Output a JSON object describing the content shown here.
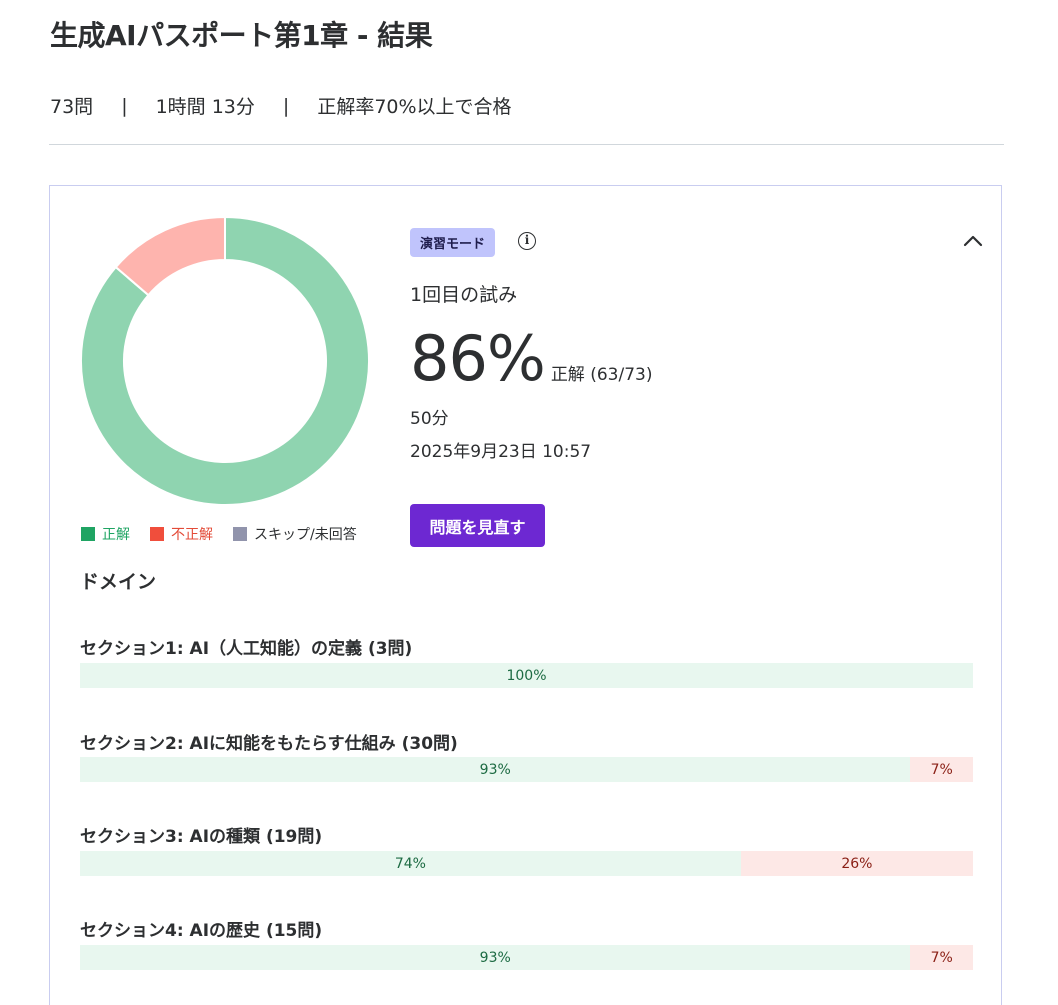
{
  "header": {
    "title": "生成AIパスポート第1章 - 結果",
    "questions": "73問",
    "separator": "|",
    "time": "1時間 13分",
    "pass_rule": "正解率70%以上で合格"
  },
  "result": {
    "mode_badge": "演習モード",
    "info_icon": "info-icon",
    "collapse_icon": "chevron-up-icon",
    "attempt": "1回目の試み",
    "score_pct": "86%",
    "score_label": "正解 (63/73)",
    "duration": "50分",
    "date": "2025年9月23日 10:57",
    "review_button": "問題を見直す"
  },
  "chart_data": {
    "type": "pie",
    "categories": [
      "正解",
      "不正解",
      "スキップ/未回答"
    ],
    "values": [
      63,
      10,
      0
    ],
    "colors": [
      "#8fd4b0",
      "#feb4ae",
      "#9194ac"
    ],
    "legend_colors": [
      "#1fa463",
      "#f04e3c",
      "#9194ac"
    ],
    "legend": "bottom"
  },
  "legend": [
    {
      "label": "正解",
      "color": "#1fa463",
      "text_color": "#1fa463"
    },
    {
      "label": "不正解",
      "color": "#f04e3c",
      "text_color": "#e34b38"
    },
    {
      "label": "スキップ/未回答",
      "color": "#9194ac",
      "text_color": "#2d2f31"
    }
  ],
  "domain": {
    "heading": "ドメイン",
    "sections": [
      {
        "title": "セクション1: AI（人工知能）の定義 (3問)",
        "correct": 100,
        "correct_label": "100%",
        "wrong": 0,
        "wrong_label": ""
      },
      {
        "title": "セクション2: AIに知能をもたらす仕組み (30問)",
        "correct": 93,
        "correct_label": "93%",
        "wrong": 7,
        "wrong_label": "7%"
      },
      {
        "title": "セクション3: AIの種類 (19問)",
        "correct": 74,
        "correct_label": "74%",
        "wrong": 26,
        "wrong_label": "26%"
      },
      {
        "title": "セクション4: AIの歴史 (15問)",
        "correct": 93,
        "correct_label": "93%",
        "wrong": 7,
        "wrong_label": "7%"
      }
    ]
  }
}
